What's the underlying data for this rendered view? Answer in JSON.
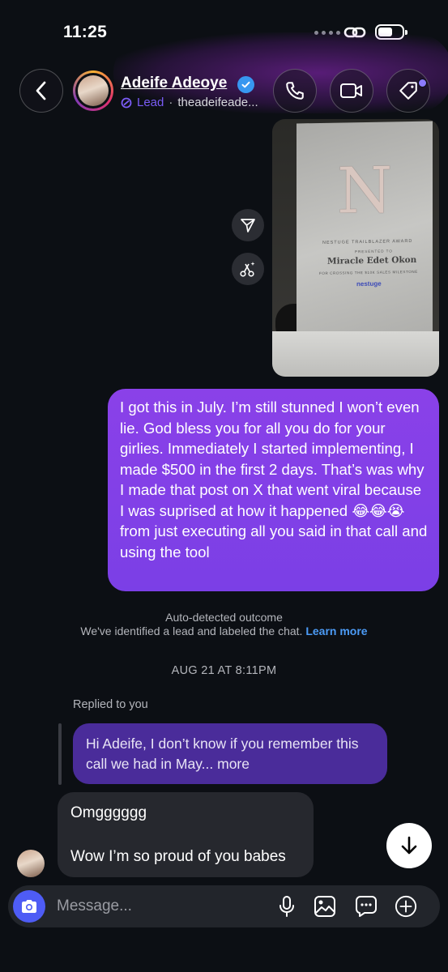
{
  "status_bar": {
    "time": "11:25"
  },
  "header": {
    "name": "Adeife Adeoye",
    "label": "Lead",
    "separator": "·",
    "handle": "theadeifeade..."
  },
  "photo_message": {
    "plaque_logo": "N",
    "plaque_award": "NESTUGE TRAILBLAZER AWARD",
    "plaque_presented": "PRESENTED TO",
    "plaque_name": "Miracle Edet Okon",
    "plaque_for": "FOR CROSSING THE $10K SALES MILESTONE",
    "plaque_brand": "nestuge"
  },
  "messages": {
    "outgoing_text": "I got this in July. I’m still stunned I won’t even lie. God bless you for all you do for your girlies. Immediately I started implementing, I made $500 in the first 2 days. That’s was why I made that post on X that went viral because I was suprised at how it happened 😂😂😭 from just executing all you said in that call and using the tool",
    "auto_title": "Auto-detected outcome",
    "auto_desc": "We've identified a lead and labeled the chat.",
    "learn_more": "Learn more",
    "date": "AUG 21 AT 8:11PM",
    "replied_to": "Replied to you",
    "reply_quote": "Hi Adeife, I don’t know if you remember this call we had in May...",
    "reply_more": "more",
    "incoming_line1": "Omgggggg",
    "incoming_line2": "Wow I’m so proud of you babes"
  },
  "composer": {
    "placeholder": "Message..."
  },
  "colors": {
    "background": "#0c0f14",
    "outgoing_bubble": "#8a41e8",
    "reply_bubble": "#4a2c9a",
    "incoming_bubble": "#26282e",
    "lead_label": "#7a5cf5",
    "link": "#4c9bf6",
    "camera_button": "#4e5cf5"
  },
  "icons": [
    "back-chevron-icon",
    "verified-badge-icon",
    "lead-icon",
    "phone-icon",
    "video-camera-icon",
    "tag-icon",
    "share-send-icon",
    "ai-scissors-icon",
    "arrow-down-icon",
    "camera-icon",
    "microphone-icon",
    "gallery-icon",
    "sticker-chat-icon",
    "plus-icon",
    "link-icon",
    "battery-icon"
  ]
}
